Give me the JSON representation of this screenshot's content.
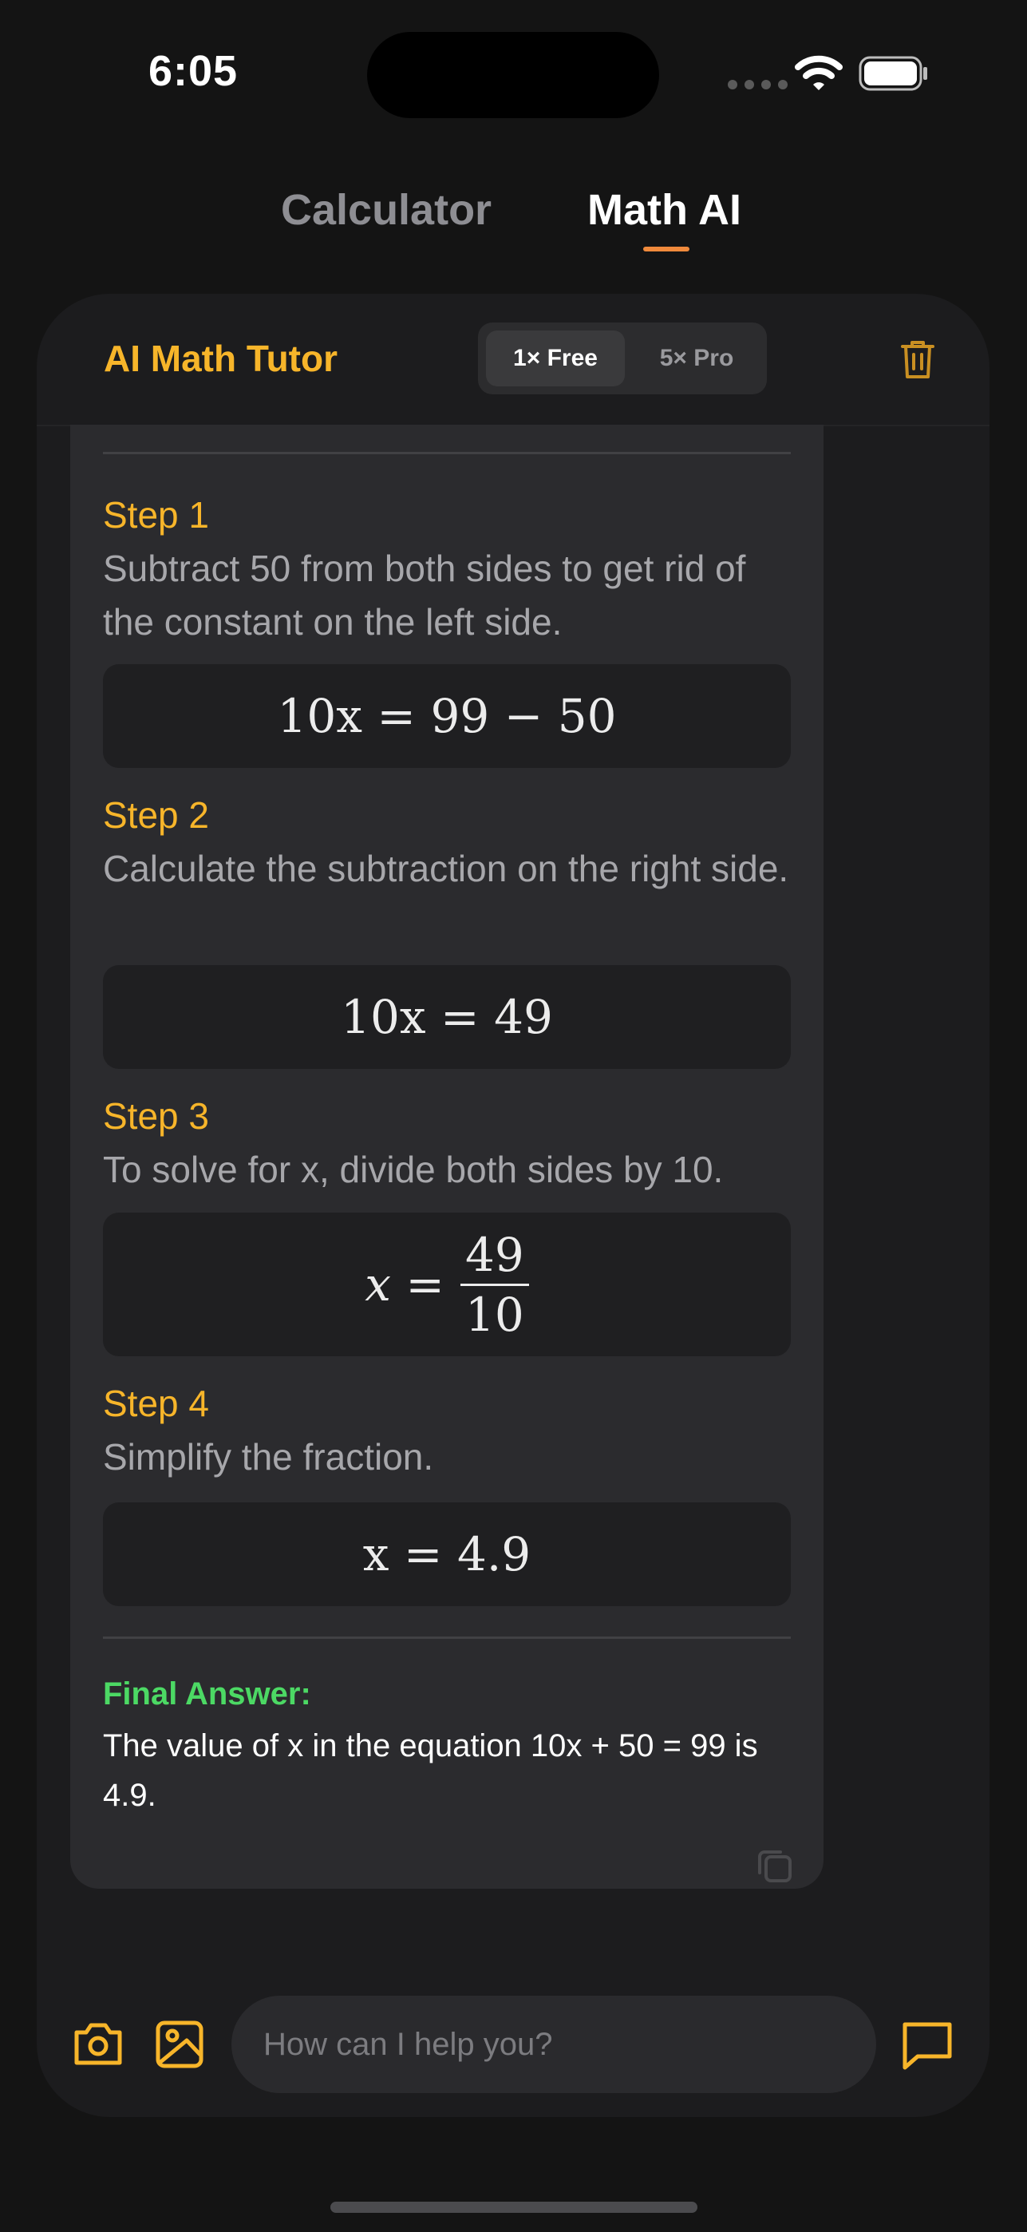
{
  "status_bar": {
    "time": "6:05",
    "icons": [
      "signal-dots-icon",
      "wifi-icon",
      "battery-icon"
    ]
  },
  "tabs": [
    {
      "label": "Calculator",
      "active": false
    },
    {
      "label": "Math AI",
      "active": true
    }
  ],
  "colors": {
    "accent": "#f7b52a",
    "tab_underline": "#f08a3c",
    "final_answer": "#4cd964",
    "background": "#141414",
    "card": "#1c1c1e",
    "bubble": "#2b2b2e"
  },
  "header": {
    "title": "AI Math Tutor",
    "segments": [
      {
        "label": "1× Free",
        "selected": true
      },
      {
        "label": "5× Pro",
        "selected": false
      }
    ],
    "trash_icon": "trash-icon"
  },
  "steps": [
    {
      "title": "Step 1",
      "description": "Subtract 50 from both sides to get rid of the constant on the left side.",
      "equation": "10x = 99 − 50"
    },
    {
      "title": "Step 2",
      "description": "Calculate the subtraction on the right side.",
      "equation": "10x = 49"
    },
    {
      "title": "Step 3",
      "description": "To solve for x, divide both sides by 10.",
      "equation": "x = 49/10",
      "fraction": {
        "numerator": "49",
        "denominator": "10"
      }
    },
    {
      "title": "Step 4",
      "description": "Simplify the fraction.",
      "equation": "x = 4.9"
    }
  ],
  "final": {
    "label": "Final Answer:",
    "text": "The value of x in the equation 10x + 50 = 99 is 4.9."
  },
  "input_bar": {
    "placeholder": "How can I help you?",
    "icons": [
      "camera-icon",
      "image-icon",
      "chat-icon"
    ]
  }
}
